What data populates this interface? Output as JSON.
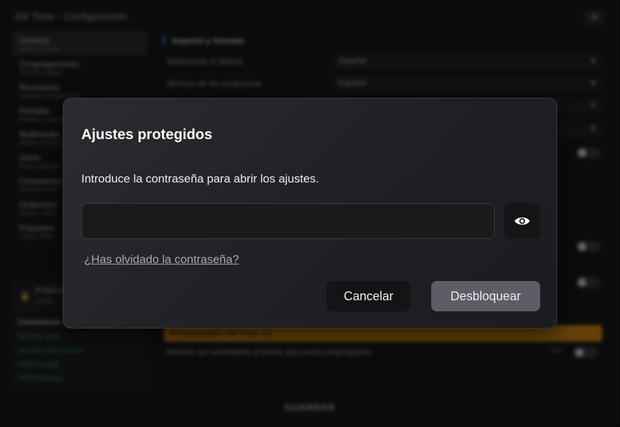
{
  "window": {
    "title": "JW Time - Configuración",
    "close_glyph": "✕"
  },
  "sidebar": {
    "items": [
      {
        "label": "General",
        "sub": "Idioma y tema"
      },
      {
        "label": "Congregaciones",
        "sub": "Perfiles y datos"
      },
      {
        "label": "Reuniones",
        "sub": "Horarios y duraciones"
      },
      {
        "label": "Pantalla",
        "sub": "Monitor y ventana"
      },
      {
        "label": "Multimedia",
        "sub": "Música y fondos"
      },
      {
        "label": "Zoom",
        "sub": "Reloj y tiempos"
      },
      {
        "label": "Conexiones",
        "sub": "Servidor y red"
      },
      {
        "label": "Grabación",
        "sub": "Audio y video"
      },
      {
        "label": "Paquetes",
        "sub": "Copia offline"
      }
    ],
    "protected": {
      "label": "Protección",
      "sub": "Activa"
    },
    "connections": {
      "header": "Conexiones",
      "items": [
        "Servidor Web",
        "Servidor Web remoto",
        "WEB (jw.org)",
        "WEB (backup)"
      ]
    }
  },
  "content": {
    "section_title": "Aspecto y formato",
    "rows": [
      {
        "label": "Seleccione el idioma",
        "value": "Español"
      },
      {
        "label": "Idiomas de los programas",
        "value": "Español"
      }
    ],
    "news_bar": "NOVEDADES JW Time 4.2",
    "news_row": "Mostrar las novedades al iniciar para esta congregación",
    "news_state": "ON"
  },
  "footer": {
    "save_label": "GUARDAR"
  },
  "modal": {
    "title": "Ajustes protegidos",
    "description": "Introduce la contraseña para abrir los ajustes.",
    "password_value": "",
    "password_placeholder": "",
    "forgot_link": "¿Has olvidado la contraseña?",
    "cancel_label": "Cancelar",
    "unlock_label": "Desbloquear"
  },
  "icons": {
    "show_password": "eye-icon",
    "lock": "lock-icon",
    "close": "close-icon"
  },
  "colors": {
    "accent_orange": "#e8950c",
    "status_green": "#3bb552",
    "unlock_button": "#5d5d66"
  }
}
